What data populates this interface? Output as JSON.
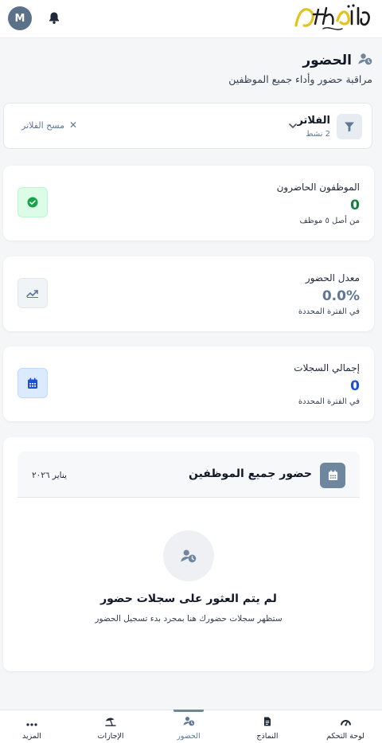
{
  "header": {
    "avatar_initial": "M",
    "logo_text": "اتشا",
    "logo_subtext": "Attha Plus"
  },
  "page": {
    "title": "الحضور",
    "subtitle": "مراقبة حضور وأداء جميع الموظفين"
  },
  "filters": {
    "title": "الفلاتر",
    "active_count": "2 نشط",
    "clear_label": "مسح الفلاتر"
  },
  "stats": [
    {
      "label": "الموظفون الحاضرون",
      "value": "0",
      "note": "من أصل ٥ موظف",
      "color": "#15803d"
    },
    {
      "label": "معدل الحضور",
      "value": "0.0%",
      "note": "في الفترة المحددة",
      "color": "#5f7896"
    },
    {
      "label": "إجمالي السجلات",
      "value": "0",
      "note": "في الفترة المحددة",
      "color": "#1d4ed8"
    }
  ],
  "attendance_panel": {
    "title": "حضور جميع الموظفين",
    "date": "يناير ٢٠٢٦",
    "empty_title": "لم يتم العثور على سجلات حضور",
    "empty_desc": "ستظهر سجلات حضورك هنا بمجرد بدء تسجيل الحضور"
  },
  "bottom_nav": {
    "items": [
      {
        "label": "لوحة التحكم",
        "icon": "dashboard-icon"
      },
      {
        "label": "النماذج",
        "icon": "document-icon"
      },
      {
        "label": "الحضور",
        "icon": "attendance-icon",
        "active": true
      },
      {
        "label": "الإجازات",
        "icon": "beach-umbrella-icon"
      },
      {
        "label": "المزيد",
        "icon": "more-icon"
      }
    ]
  },
  "colors": {
    "accent": "#6f869f",
    "success": "#15803d",
    "info": "#1d4ed8"
  }
}
